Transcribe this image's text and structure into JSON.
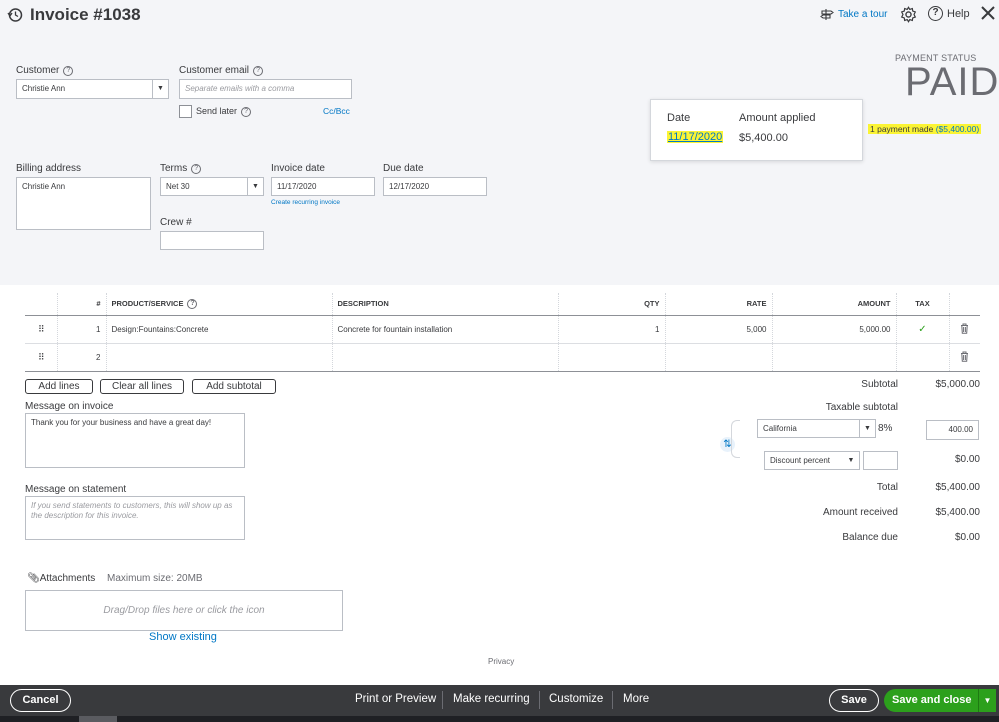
{
  "header": {
    "title": "Invoice #1038",
    "take_tour": "Take a tour",
    "help": "Help"
  },
  "customer": {
    "label": "Customer",
    "value": "Christie Ann",
    "email_label": "Customer email",
    "email_placeholder": "Separate emails with a comma",
    "send_later": "Send later",
    "cc_bcc": "Cc/Bcc"
  },
  "payment": {
    "status_label": "PAYMENT STATUS",
    "status": "PAID",
    "date_header": "Date",
    "amount_header": "Amount applied",
    "date": "11/17/2020",
    "amount": "$5,400.00",
    "made_text": "1 payment made",
    "made_amount": "($5,400.00)"
  },
  "billing": {
    "label": "Billing address",
    "value": "Christie Ann"
  },
  "terms": {
    "label": "Terms",
    "value": "Net 30"
  },
  "invoice_date": {
    "label": "Invoice date",
    "value": "11/17/2020"
  },
  "create_recurring": "Create recurring invoice",
  "due_date": {
    "label": "Due date",
    "value": "12/17/2020"
  },
  "crew": {
    "label": "Crew #",
    "value": ""
  },
  "table": {
    "headers": [
      "#",
      "PRODUCT/SERVICE",
      "DESCRIPTION",
      "QTY",
      "RATE",
      "AMOUNT",
      "TAX"
    ],
    "rows": [
      {
        "num": "1",
        "product": "Design:Fountains:Concrete",
        "description": "Concrete for fountain installation",
        "qty": "1",
        "rate": "5,000",
        "amount": "5,000.00",
        "tax": "✓"
      },
      {
        "num": "2",
        "product": "",
        "description": "",
        "qty": "",
        "rate": "",
        "amount": "",
        "tax": ""
      }
    ]
  },
  "buttons": {
    "add_lines": "Add lines",
    "clear_all_lines": "Clear all lines",
    "add_subtotal": "Add subtotal"
  },
  "message_invoice": {
    "label": "Message on invoice",
    "value": "Thank you for your business and have a great day!"
  },
  "message_statement": {
    "label": "Message on statement",
    "placeholder": "If you send statements to customers, this will show up as the description for this invoice."
  },
  "attachments": {
    "label": "Attachments",
    "max_size": "Maximum size: 20MB",
    "drop_text": "Drag/Drop files here or click the icon",
    "show_existing": "Show existing"
  },
  "totals": {
    "subtotal_label": "Subtotal",
    "subtotal": "$5,000.00",
    "taxable_label": "Taxable subtotal",
    "tax_region": "California",
    "tax_rate": "8%",
    "tax_amount": "400.00",
    "discount_select": "Discount percent",
    "discount_value": "$0.00",
    "total_label": "Total",
    "total": "$5,400.00",
    "received_label": "Amount received",
    "received": "$5,400.00",
    "balance_label": "Balance due",
    "balance": "$0.00"
  },
  "privacy": "Privacy",
  "footer": {
    "cancel": "Cancel",
    "print_preview": "Print or Preview",
    "make_recurring": "Make recurring",
    "customize": "Customize",
    "more": "More",
    "save": "Save",
    "save_close": "Save and close"
  },
  "colors": {
    "accent_blue": "#0077c5",
    "green": "#2ca01c",
    "highlight": "#fbf434",
    "footer_bg": "#393a3d"
  }
}
